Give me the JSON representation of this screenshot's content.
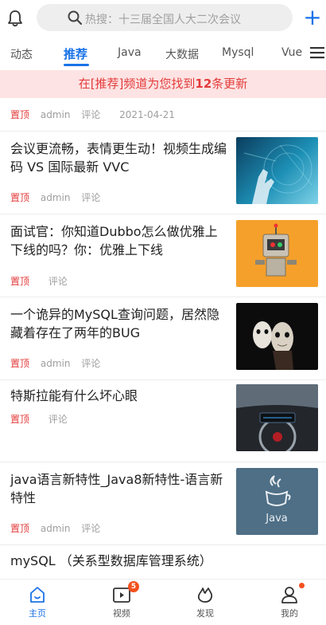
{
  "header": {
    "search_placeholder": "热搜：十三届全国人大二次会议",
    "plus": "+"
  },
  "tabs": [
    {
      "label": "动态"
    },
    {
      "label": "推荐"
    },
    {
      "label": "Java"
    },
    {
      "label": "大数据"
    },
    {
      "label": "Mysql"
    },
    {
      "label": "Vue"
    }
  ],
  "banner": {
    "prefix": "在[推荐]频道为您找到",
    "count": "12",
    "suffix": "条更新"
  },
  "feed": [
    {
      "title": "",
      "top": "置顶",
      "author": "admin",
      "comment": "评论",
      "date": "2021-04-21"
    },
    {
      "title": "会议更流畅，表情更生动！视频生成编码 VS 国际最新 VVC",
      "top": "置顶",
      "author": "admin",
      "comment": "评论"
    },
    {
      "title": "面试官：你知道Dubbo怎么做优雅上下线的吗？你：优雅上下线",
      "top": "置顶",
      "author": "",
      "comment": "评论"
    },
    {
      "title": "一个诡异的MySQL查询问题，居然隐藏着存在了两年的BUG",
      "top": "置顶",
      "author": "admin",
      "comment": "评论"
    },
    {
      "title": "特斯拉能有什么坏心眼",
      "top": "置顶",
      "author": "",
      "comment": "评论"
    },
    {
      "title": "java语言新特性_Java8新特性-语言新特性",
      "top": "置顶",
      "author": "admin",
      "comment": "评论"
    },
    {
      "title": "mySQL （关系型数据库管理系统）"
    }
  ],
  "thumb_text": {
    "java_logo": "Java"
  },
  "bottom_nav": [
    {
      "label": "主页",
      "icon": "home-icon"
    },
    {
      "label": "视频",
      "icon": "video-icon",
      "badge": "5"
    },
    {
      "label": "发现",
      "icon": "discover-icon"
    },
    {
      "label": "我的",
      "icon": "profile-icon"
    }
  ],
  "colors": {
    "accent": "#1a73e8",
    "red": "#e33b3b",
    "banner_bg": "#fde3e3"
  }
}
